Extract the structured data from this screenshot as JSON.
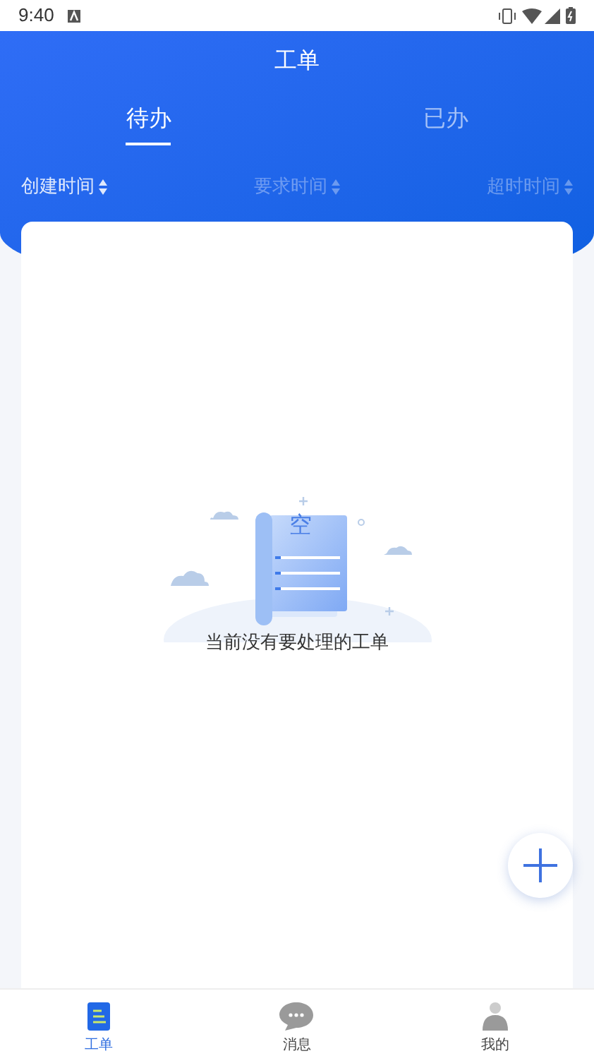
{
  "status_bar": {
    "time": "9:40"
  },
  "header": {
    "title": "工单"
  },
  "tabs": [
    {
      "label": "待办",
      "selected": true
    },
    {
      "label": "已办",
      "selected": false
    }
  ],
  "sort_fields": [
    {
      "label": "创建时间",
      "selected": true
    },
    {
      "label": "要求时间",
      "selected": false
    },
    {
      "label": "超时时间",
      "selected": false
    }
  ],
  "empty_state": {
    "illustration_label": "空",
    "message": "当前没有要处理的工单"
  },
  "bottom_nav": [
    {
      "label": "工单",
      "selected": true,
      "kind": "orders"
    },
    {
      "label": "消息",
      "selected": false,
      "kind": "messages"
    },
    {
      "label": "我的",
      "selected": false,
      "kind": "profile"
    }
  ]
}
